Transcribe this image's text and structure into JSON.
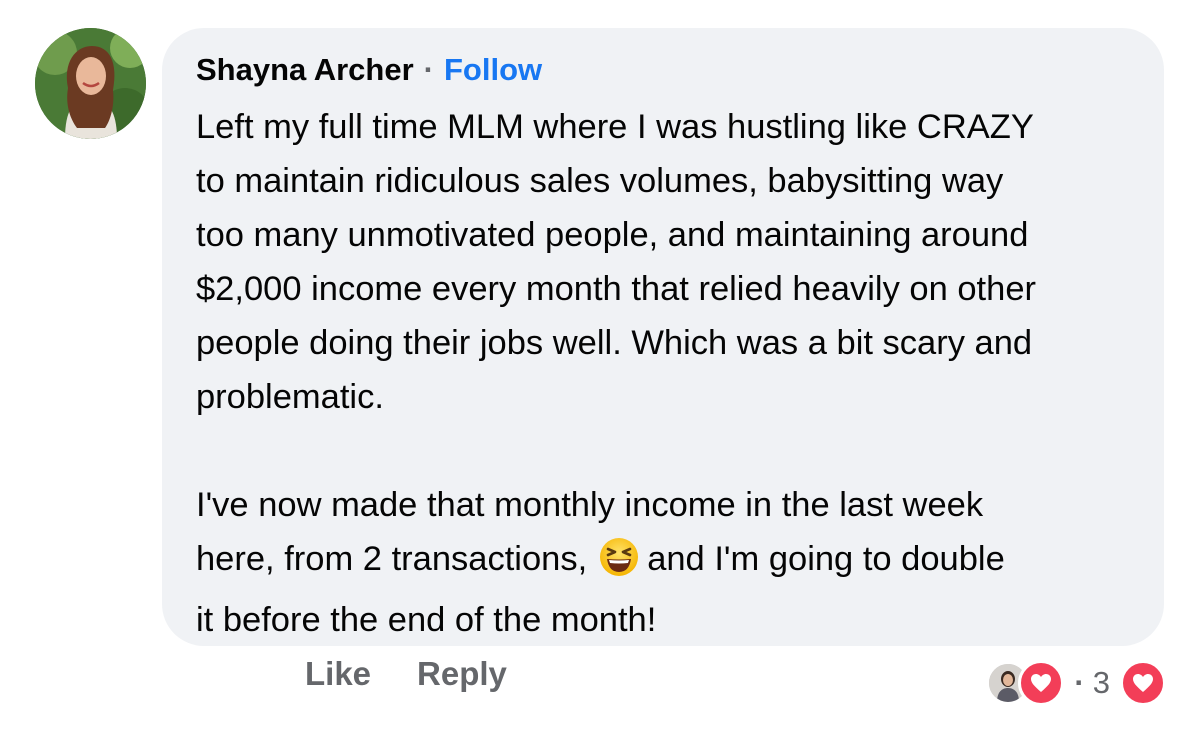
{
  "comment": {
    "author": "Shayna Archer",
    "separator": "·",
    "follow_label": "Follow",
    "paragraph1": [
      "Left my full time MLM where I was hustling like CRAZY",
      "to maintain ridiculous sales volumes, babysitting way",
      "too many unmotivated people, and maintaining around",
      "$2,000 income every month that relied heavily on other",
      "people doing their jobs well. Which was a bit scary and",
      "problematic."
    ],
    "paragraph2": {
      "line1": "I've now made that monthly income in the last week",
      "line2_before": "here, from 2 transactions,",
      "emoji_name": "laughing-squinting-face-icon",
      "line2_after": "and I'm going to double",
      "line3": "it before the end of the month!"
    }
  },
  "actions": {
    "like_label": "Like",
    "reply_label": "Reply"
  },
  "reactions": {
    "separator": "·",
    "count": "3",
    "icon": "heart-icon"
  },
  "colors": {
    "bubble_bg": "#f0f2f5",
    "link_blue": "#1877f2",
    "secondary_text": "#65676b",
    "heart_red": "#f33e58"
  }
}
